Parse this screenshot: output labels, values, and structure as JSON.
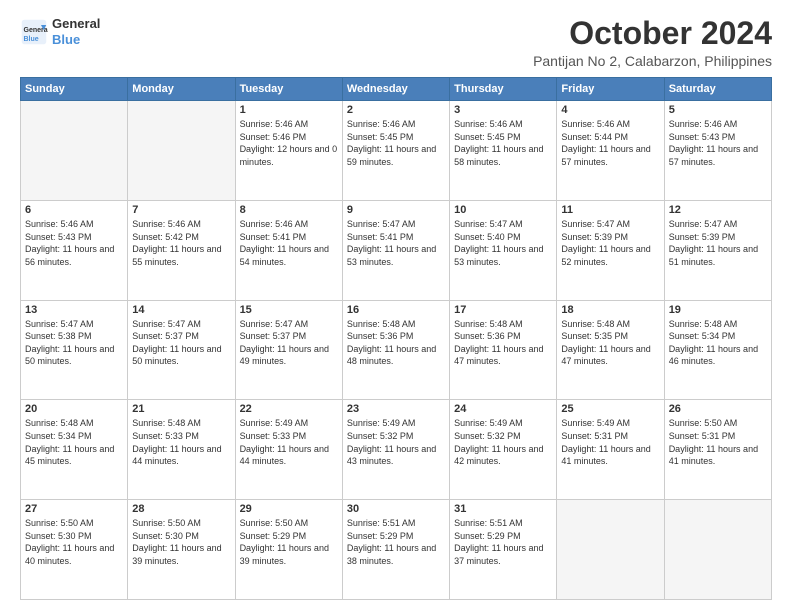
{
  "logo": {
    "line1": "General",
    "line2": "Blue"
  },
  "title": "October 2024",
  "subtitle": "Pantijan No 2, Calabarzon, Philippines",
  "days_of_week": [
    "Sunday",
    "Monday",
    "Tuesday",
    "Wednesday",
    "Thursday",
    "Friday",
    "Saturday"
  ],
  "weeks": [
    [
      {
        "day": "",
        "empty": true
      },
      {
        "day": "",
        "empty": true
      },
      {
        "day": "1",
        "sunrise": "5:46 AM",
        "sunset": "5:46 PM",
        "daylight": "12 hours and 0 minutes."
      },
      {
        "day": "2",
        "sunrise": "5:46 AM",
        "sunset": "5:45 PM",
        "daylight": "11 hours and 59 minutes."
      },
      {
        "day": "3",
        "sunrise": "5:46 AM",
        "sunset": "5:45 PM",
        "daylight": "11 hours and 58 minutes."
      },
      {
        "day": "4",
        "sunrise": "5:46 AM",
        "sunset": "5:44 PM",
        "daylight": "11 hours and 57 minutes."
      },
      {
        "day": "5",
        "sunrise": "5:46 AM",
        "sunset": "5:43 PM",
        "daylight": "11 hours and 57 minutes."
      }
    ],
    [
      {
        "day": "6",
        "sunrise": "5:46 AM",
        "sunset": "5:43 PM",
        "daylight": "11 hours and 56 minutes."
      },
      {
        "day": "7",
        "sunrise": "5:46 AM",
        "sunset": "5:42 PM",
        "daylight": "11 hours and 55 minutes."
      },
      {
        "day": "8",
        "sunrise": "5:46 AM",
        "sunset": "5:41 PM",
        "daylight": "11 hours and 54 minutes."
      },
      {
        "day": "9",
        "sunrise": "5:47 AM",
        "sunset": "5:41 PM",
        "daylight": "11 hours and 53 minutes."
      },
      {
        "day": "10",
        "sunrise": "5:47 AM",
        "sunset": "5:40 PM",
        "daylight": "11 hours and 53 minutes."
      },
      {
        "day": "11",
        "sunrise": "5:47 AM",
        "sunset": "5:39 PM",
        "daylight": "11 hours and 52 minutes."
      },
      {
        "day": "12",
        "sunrise": "5:47 AM",
        "sunset": "5:39 PM",
        "daylight": "11 hours and 51 minutes."
      }
    ],
    [
      {
        "day": "13",
        "sunrise": "5:47 AM",
        "sunset": "5:38 PM",
        "daylight": "11 hours and 50 minutes."
      },
      {
        "day": "14",
        "sunrise": "5:47 AM",
        "sunset": "5:37 PM",
        "daylight": "11 hours and 50 minutes."
      },
      {
        "day": "15",
        "sunrise": "5:47 AM",
        "sunset": "5:37 PM",
        "daylight": "11 hours and 49 minutes."
      },
      {
        "day": "16",
        "sunrise": "5:48 AM",
        "sunset": "5:36 PM",
        "daylight": "11 hours and 48 minutes."
      },
      {
        "day": "17",
        "sunrise": "5:48 AM",
        "sunset": "5:36 PM",
        "daylight": "11 hours and 47 minutes."
      },
      {
        "day": "18",
        "sunrise": "5:48 AM",
        "sunset": "5:35 PM",
        "daylight": "11 hours and 47 minutes."
      },
      {
        "day": "19",
        "sunrise": "5:48 AM",
        "sunset": "5:34 PM",
        "daylight": "11 hours and 46 minutes."
      }
    ],
    [
      {
        "day": "20",
        "sunrise": "5:48 AM",
        "sunset": "5:34 PM",
        "daylight": "11 hours and 45 minutes."
      },
      {
        "day": "21",
        "sunrise": "5:48 AM",
        "sunset": "5:33 PM",
        "daylight": "11 hours and 44 minutes."
      },
      {
        "day": "22",
        "sunrise": "5:49 AM",
        "sunset": "5:33 PM",
        "daylight": "11 hours and 44 minutes."
      },
      {
        "day": "23",
        "sunrise": "5:49 AM",
        "sunset": "5:32 PM",
        "daylight": "11 hours and 43 minutes."
      },
      {
        "day": "24",
        "sunrise": "5:49 AM",
        "sunset": "5:32 PM",
        "daylight": "11 hours and 42 minutes."
      },
      {
        "day": "25",
        "sunrise": "5:49 AM",
        "sunset": "5:31 PM",
        "daylight": "11 hours and 41 minutes."
      },
      {
        "day": "26",
        "sunrise": "5:50 AM",
        "sunset": "5:31 PM",
        "daylight": "11 hours and 41 minutes."
      }
    ],
    [
      {
        "day": "27",
        "sunrise": "5:50 AM",
        "sunset": "5:30 PM",
        "daylight": "11 hours and 40 minutes."
      },
      {
        "day": "28",
        "sunrise": "5:50 AM",
        "sunset": "5:30 PM",
        "daylight": "11 hours and 39 minutes."
      },
      {
        "day": "29",
        "sunrise": "5:50 AM",
        "sunset": "5:29 PM",
        "daylight": "11 hours and 39 minutes."
      },
      {
        "day": "30",
        "sunrise": "5:51 AM",
        "sunset": "5:29 PM",
        "daylight": "11 hours and 38 minutes."
      },
      {
        "day": "31",
        "sunrise": "5:51 AM",
        "sunset": "5:29 PM",
        "daylight": "11 hours and 37 minutes."
      },
      {
        "day": "",
        "empty": true
      },
      {
        "day": "",
        "empty": true
      }
    ]
  ]
}
